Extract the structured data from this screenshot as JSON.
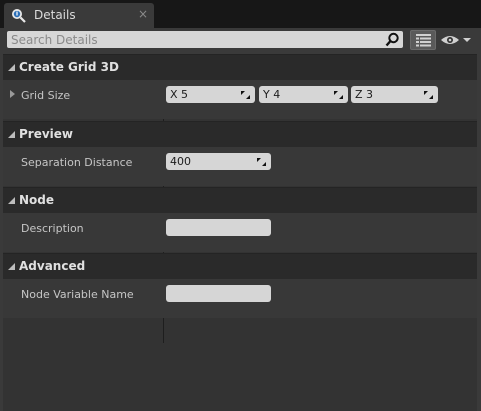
{
  "tab": {
    "title": "Details",
    "close": "×"
  },
  "search": {
    "placeholder": "Search Details"
  },
  "colors": {
    "panel": "#3a3a3a",
    "category": "#2a2a2a",
    "field": "#d6d6d6"
  },
  "categories": [
    {
      "title": "Create Grid 3D",
      "rows": [
        {
          "label": "Grid Size",
          "fields": [
            "X  5",
            "Y  4",
            "Z  3"
          ]
        }
      ]
    },
    {
      "title": "Preview",
      "rows": [
        {
          "label": "Separation Distance",
          "value": "400"
        }
      ]
    },
    {
      "title": "Node",
      "rows": [
        {
          "label": "Description",
          "value": ""
        }
      ]
    },
    {
      "title": "Advanced",
      "rows": [
        {
          "label": "Node Variable Name",
          "value": ""
        }
      ]
    }
  ]
}
